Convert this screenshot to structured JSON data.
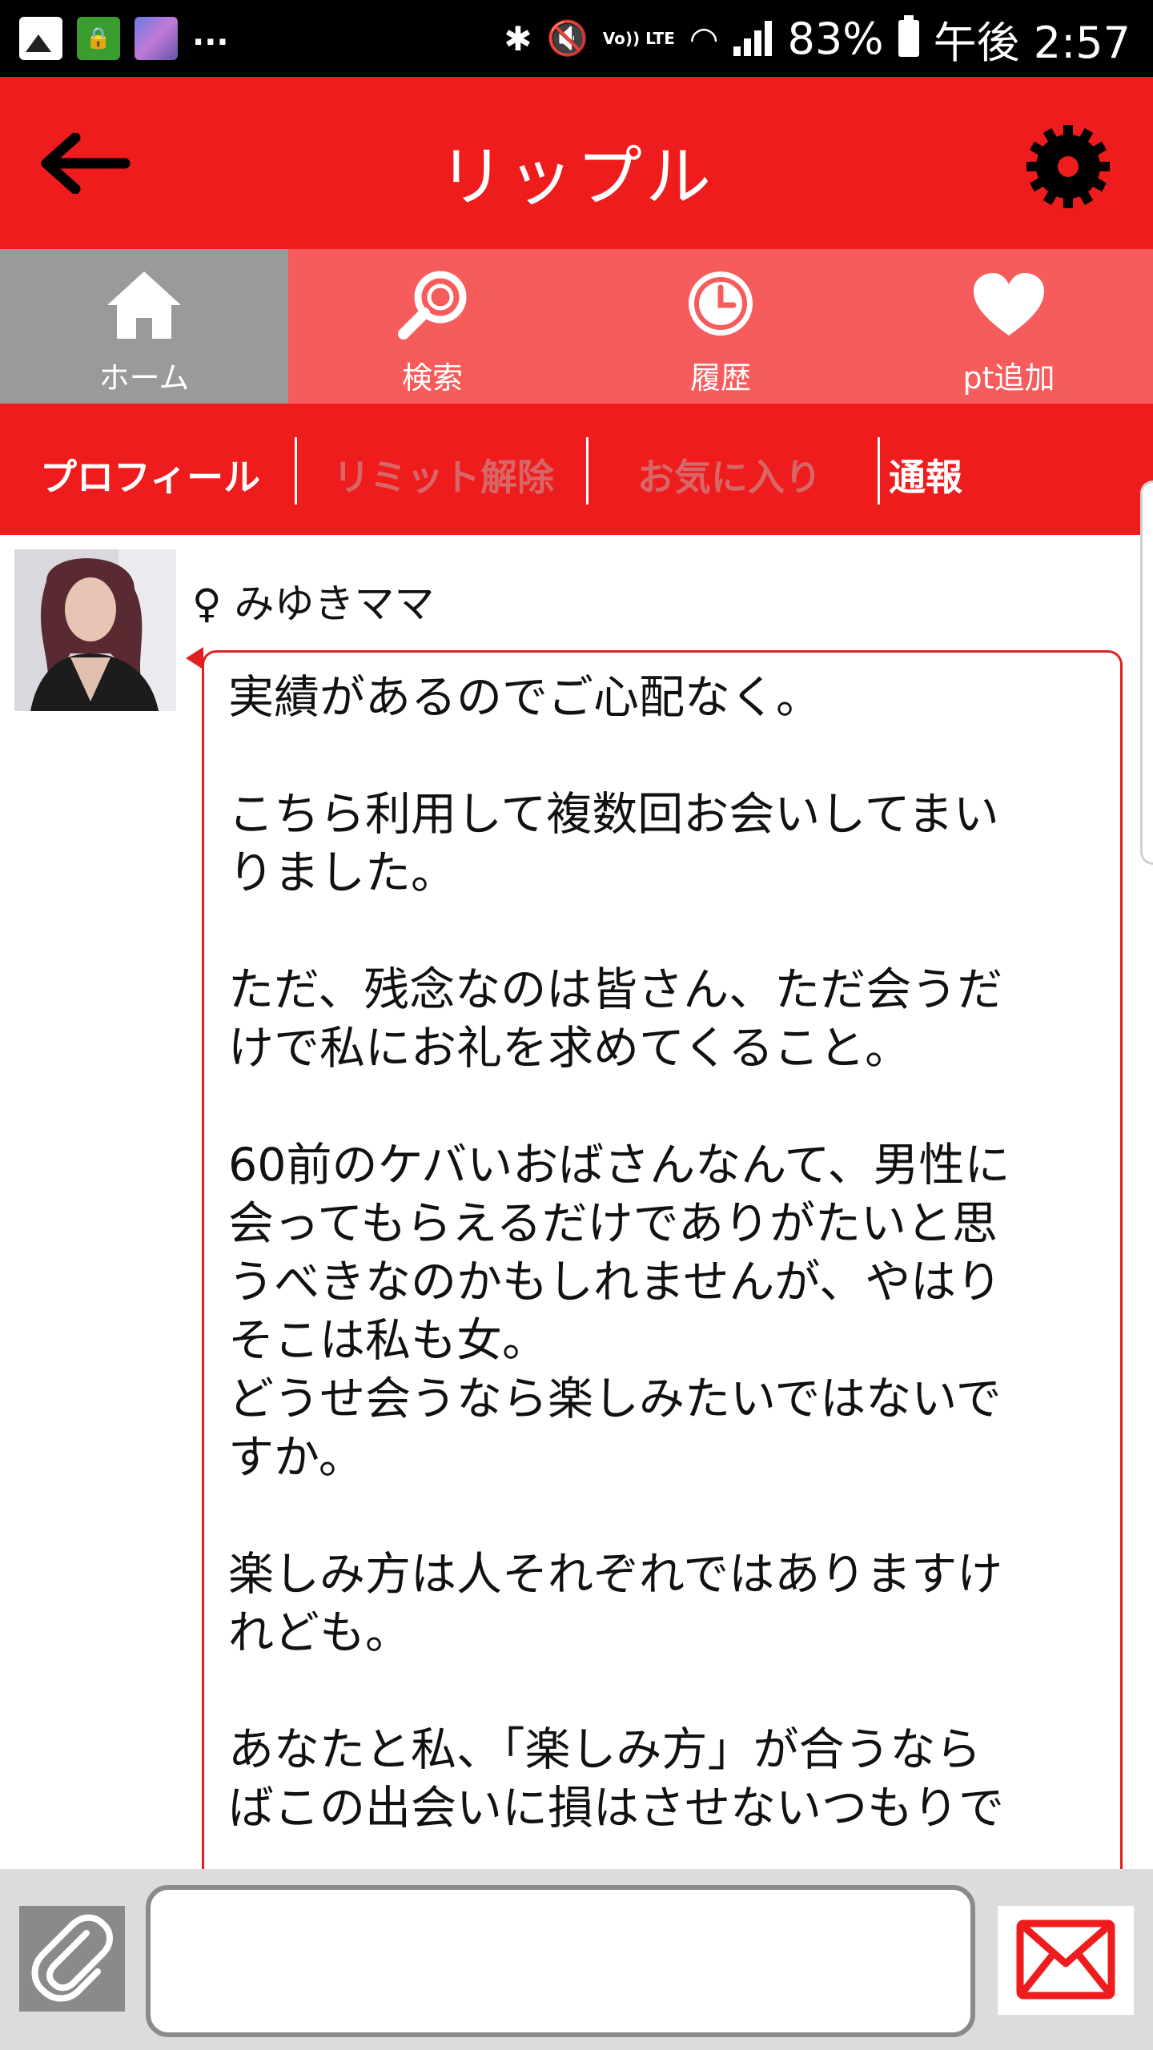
{
  "status_bar": {
    "more": "...",
    "battery": "83%",
    "time": "午後 2:57",
    "lte": "Vo)) LTE"
  },
  "app_bar": {
    "title": "リップル"
  },
  "nav": {
    "items": [
      {
        "label": "ホーム",
        "icon": "home-icon"
      },
      {
        "label": "検索",
        "icon": "search-icon"
      },
      {
        "label": "履歴",
        "icon": "clock-icon"
      },
      {
        "label": "pt追加",
        "icon": "heart-icon"
      }
    ]
  },
  "sub_tabs": {
    "profile": "プロフィール",
    "limit_release": "リミット解除",
    "favorite": "お気に入り",
    "report": "通報"
  },
  "profile": {
    "gender_symbol": "♀",
    "name": "みゆきママ"
  },
  "message": {
    "text": "実績があるのでご心配なく。\n\nこちら利用して複数回お会いしてまい\nりました。\n\nただ、残念なのは皆さん、ただ会うだ\nけで私にお礼を求めてくること。\n\n60前のケバいおばさんなんて、男性に\n会ってもらえるだけでありがたいと思\nうべきなのかもしれませんが、やはり\nそこは私も女。\nどうせ会うなら楽しみたいではないで\nすか。\n\n楽しみ方は人それぞれではありますけ\nれども。\n\nあなたと私、「楽しみ方」が合うなら\nばこの出会いに損はさせないつもりで"
  },
  "input_bar": {
    "placeholder": ""
  },
  "colors": {
    "primary_red": "#ee1c1c",
    "nav_light_red": "#f75c5c",
    "nav_active_gray": "#9a9a9a",
    "dim_tab_text": "#d96666"
  }
}
